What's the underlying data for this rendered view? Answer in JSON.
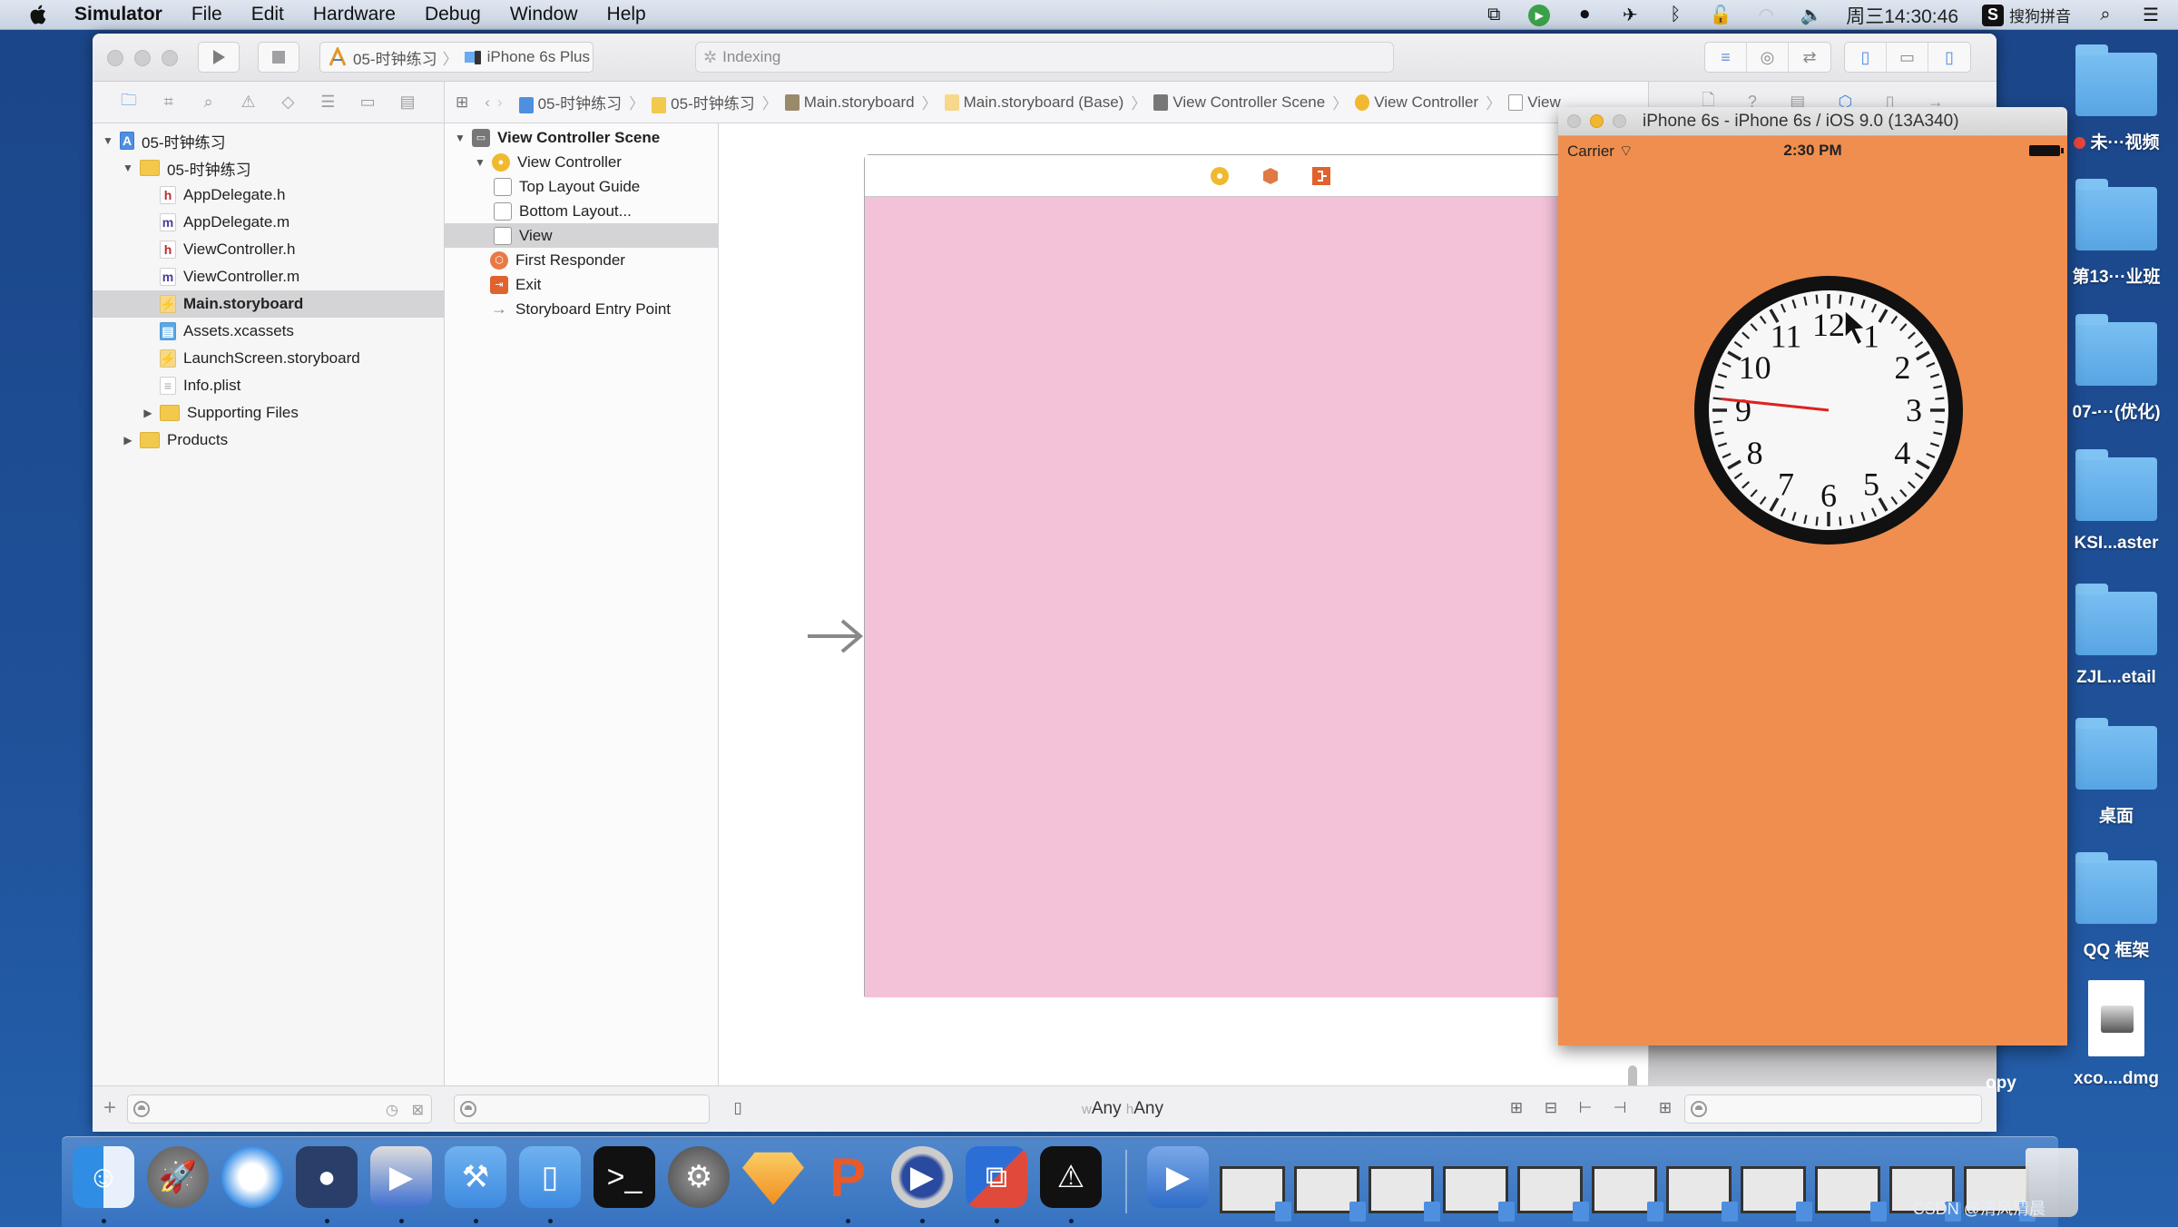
{
  "menubar": {
    "app_name": "Simulator",
    "items": [
      "File",
      "Edit",
      "Hardware",
      "Debug",
      "Window",
      "Help"
    ],
    "clock": "周三14:30:46",
    "input_method": "搜狗拼音",
    "status_icons": [
      "display-mirror-icon",
      "green-play-icon",
      "screen-record-icon",
      "airplane-icon",
      "bluetooth-icon",
      "lock-icon",
      "wifi-icon",
      "volume-icon"
    ]
  },
  "xcode": {
    "scheme": {
      "project": "05-时钟练习",
      "device": "iPhone 6s Plus"
    },
    "activity": "Indexing",
    "jumpbar": [
      "05-时钟练习",
      "05-时钟练习",
      "Main.storyboard",
      "Main.storyboard (Base)",
      "View Controller Scene",
      "View Controller",
      "View"
    ],
    "navigator": {
      "rows": [
        {
          "label": "05-时钟练习",
          "type": "proj",
          "indent": 0,
          "disclosure": "open"
        },
        {
          "label": "05-时钟练习",
          "type": "folder",
          "indent": 1,
          "disclosure": "open"
        },
        {
          "label": "AppDelegate.h",
          "type": "h",
          "indent": 2
        },
        {
          "label": "AppDelegate.m",
          "type": "m",
          "indent": 2
        },
        {
          "label": "ViewController.h",
          "type": "h",
          "indent": 2
        },
        {
          "label": "ViewController.m",
          "type": "m",
          "indent": 2
        },
        {
          "label": "Main.storyboard",
          "type": "sb",
          "indent": 2,
          "selected": true
        },
        {
          "label": "Assets.xcassets",
          "type": "assets",
          "indent": 2
        },
        {
          "label": "LaunchScreen.storyboard",
          "type": "sb",
          "indent": 2
        },
        {
          "label": "Info.plist",
          "type": "plist",
          "indent": 2
        },
        {
          "label": "Supporting Files",
          "type": "folder",
          "indent": 2,
          "disclosure": "closed"
        },
        {
          "label": "Products",
          "type": "folder",
          "indent": 1,
          "disclosure": "closed"
        }
      ]
    },
    "outline": {
      "rows": [
        {
          "label": "View Controller Scene",
          "type": "scene",
          "bold": true
        },
        {
          "label": "View Controller",
          "type": "vc"
        },
        {
          "label": "Top Layout Guide",
          "type": "layout"
        },
        {
          "label": "Bottom Layout...",
          "type": "layout"
        },
        {
          "label": "View",
          "type": "layout",
          "selected": true
        },
        {
          "label": "First Responder",
          "type": "fr"
        },
        {
          "label": "Exit",
          "type": "exit"
        },
        {
          "label": "Storyboard Entry Point",
          "type": "arrow"
        }
      ]
    },
    "canvas": {
      "view_color": "#f4c2d8",
      "size_class_w": "w",
      "size_class_w_value": "Any",
      "size_class_h": "h",
      "size_class_h_value": "Any"
    }
  },
  "simulator": {
    "title": "iPhone 6s - iPhone 6s / iOS 9.0 (13A340)",
    "carrier": "Carrier",
    "time": "2:30 PM",
    "background": "#f08e4f",
    "clock": {
      "numbers": [
        "12",
        "1",
        "2",
        "3",
        "4",
        "5",
        "6",
        "7",
        "8",
        "9",
        "10",
        "11"
      ],
      "second_hand_seconds": 46,
      "second_hand_color": "#e02020"
    }
  },
  "desktop": {
    "icons": [
      {
        "label": "未···视频",
        "type": "folder",
        "tag": true
      },
      {
        "label": "第13···业班",
        "type": "folder"
      },
      {
        "label": "07-···(优化)",
        "type": "folder"
      },
      {
        "label": "KSI...aster",
        "type": "folder"
      },
      {
        "label": "ZJL...etail",
        "type": "folder"
      },
      {
        "label": "桌面",
        "type": "folder"
      },
      {
        "label": "QQ 框架",
        "type": "folder"
      },
      {
        "label": "xco....dmg",
        "type": "dmg"
      }
    ],
    "partial_label": "opy"
  },
  "dock": {
    "apps": [
      {
        "name": "finder",
        "running": true
      },
      {
        "name": "launchpad",
        "running": false
      },
      {
        "name": "safari",
        "running": false
      },
      {
        "name": "mouse-app",
        "running": true
      },
      {
        "name": "video-app",
        "running": true
      },
      {
        "name": "xcode",
        "running": true
      },
      {
        "name": "simulator",
        "running": true
      },
      {
        "name": "terminal",
        "running": false
      },
      {
        "name": "system-preferences",
        "running": false
      },
      {
        "name": "sketch",
        "running": false
      },
      {
        "name": "powerpoint-app",
        "running": true
      },
      {
        "name": "quicktime",
        "running": true
      },
      {
        "name": "parallels",
        "running": true
      },
      {
        "name": "console",
        "running": true
      }
    ],
    "minimized_windows": 11,
    "watermark": "CSDN @清风清晨"
  }
}
